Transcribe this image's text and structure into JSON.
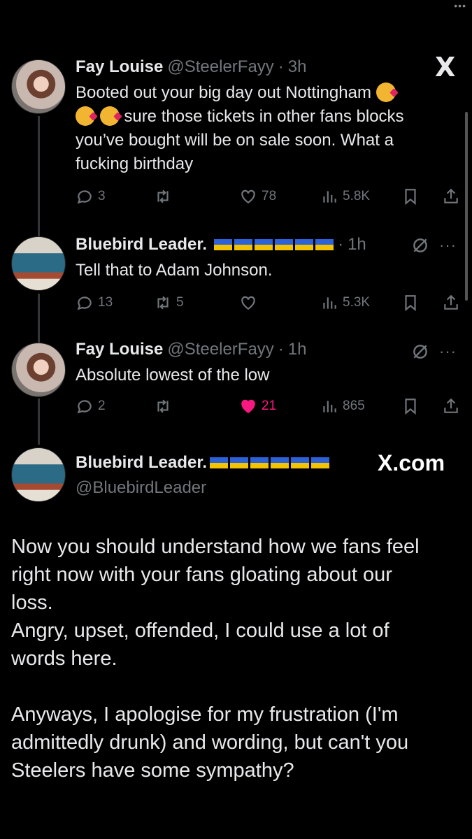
{
  "status_dots": "•••",
  "tweets": [
    {
      "name": "Fay Louise",
      "handle": "@SteelerFayy",
      "sep": "·",
      "time": "3h",
      "text_line1": "Booted out your big day out Nottingham",
      "text_line2": "sure those tickets in other fans blocks",
      "text_line3": "you’ve bought will be on sale soon. What a",
      "text_line4": "fucking birthday",
      "replies": "3",
      "retweets": "",
      "likes": "78",
      "views": "5.8K"
    },
    {
      "name": "Bluebird Leader.",
      "sep": "·",
      "time": "1h",
      "text": "Tell that to Adam Johnson.",
      "replies": "13",
      "retweets": "5",
      "likes": "",
      "views": "5.3K"
    },
    {
      "name": "Fay Louise",
      "handle": "@SteelerFayy",
      "sep": "·",
      "time": "1h",
      "text": "Absolute lowest of the low",
      "replies": "2",
      "retweets": "",
      "likes": "21",
      "views": "865"
    }
  ],
  "quote": {
    "name": "Bluebird Leader.",
    "handle": "@BluebirdLeader",
    "watermark": "X.com",
    "p1_l1": "Now you should understand how we fans feel",
    "p1_l2": "right now with your fans gloating about our",
    "p1_l3": "loss.",
    "p1_l4": "Angry, upset, offended, I could use a lot of",
    "p1_l5": "words here.",
    "p2_l1": "Anyways, I apologise for my frustration (I'm",
    "p2_l2": "admittedly drunk) and wording, but can't you",
    "p2_l3": "Steelers have some sympathy?"
  },
  "icons": {
    "x_logo": "X",
    "more": "···",
    "emoji": "kiss-emoji",
    "flag": "ukraine-flag"
  },
  "colors": {
    "background": "#000000",
    "text": "#e7e9ea",
    "muted": "#71767b",
    "like": "#f91880",
    "flag_blue": "#2d62d6",
    "flag_yellow": "#f3c300"
  }
}
